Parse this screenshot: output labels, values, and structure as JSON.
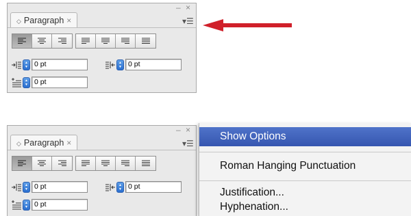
{
  "panels": [
    {
      "tab": {
        "label": "Paragraph",
        "close": "×"
      },
      "window_controls": "– ×",
      "menu_glyph": "▾☰",
      "fields": {
        "left_indent": "0 pt",
        "right_indent": "0 pt",
        "first_line_indent": "0 pt"
      }
    },
    {
      "tab": {
        "label": "Paragraph",
        "close": "×"
      },
      "window_controls": "– ×",
      "menu_glyph": "▾☰",
      "fields": {
        "left_indent": "0 pt",
        "right_indent": "0 pt",
        "first_line_indent": "0 pt"
      }
    }
  ],
  "alignment_buttons": [
    "align-left",
    "align-center",
    "align-right",
    "justify-left",
    "justify-center",
    "justify-right",
    "justify-all"
  ],
  "menu": {
    "items": [
      {
        "label": "Show Options",
        "highlighted": true
      },
      {
        "label": "Roman Hanging Punctuation"
      },
      {
        "label": "Justification..."
      },
      {
        "label": "Hyphenation..."
      }
    ]
  },
  "colors": {
    "arrow": "#d0202a",
    "menu_highlight": "#3f61bd",
    "spinner": "#2e74d6",
    "panel_bg": "#e9e9e9"
  },
  "icons": {
    "arrow": "red-left-arrow",
    "spinner": "stepper-icon",
    "left_indent": "left-indent-icon",
    "right_indent": "right-indent-icon",
    "first_line_indent": "first-line-indent-icon"
  }
}
